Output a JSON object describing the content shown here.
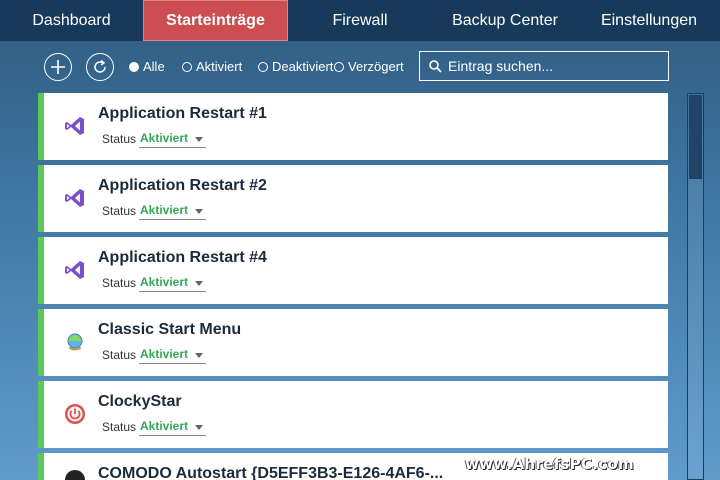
{
  "tabs": [
    {
      "label": "Dashboard",
      "active": false
    },
    {
      "label": "Starteinträge",
      "active": true
    },
    {
      "label": "Firewall",
      "active": false
    },
    {
      "label": "Backup Center",
      "active": false
    },
    {
      "label": "Einstellungen",
      "active": false
    }
  ],
  "toolbar": {
    "add_icon": "plus-icon",
    "refresh_icon": "refresh-icon",
    "filters": [
      {
        "label": "Alle",
        "checked": true
      },
      {
        "label": "Aktiviert",
        "checked": false
      },
      {
        "label": "Deaktiviert",
        "checked": false
      },
      {
        "label": "Verzögert",
        "checked": false
      }
    ],
    "search_placeholder": "Eintrag suchen..."
  },
  "entries": [
    {
      "title": "Application Restart #1",
      "status_label": "Status",
      "status": "Aktiviert",
      "icon": "visual-studio-icon"
    },
    {
      "title": "Application Restart #2",
      "status_label": "Status",
      "status": "Aktiviert",
      "icon": "visual-studio-icon"
    },
    {
      "title": "Application Restart #4",
      "status_label": "Status",
      "status": "Aktiviert",
      "icon": "visual-studio-icon"
    },
    {
      "title": "Classic Start Menu",
      "status_label": "Status",
      "status": "Aktiviert",
      "icon": "shell-icon"
    },
    {
      "title": "ClockyStar",
      "status_label": "Status",
      "status": "Aktiviert",
      "icon": "power-icon"
    },
    {
      "title": "COMODO Autostart {D5EFF3B3-E126-4AF6-...",
      "status_label": "",
      "status": "",
      "icon": "comodo-icon"
    }
  ],
  "colors": {
    "topbar": "#173a5a",
    "active_tab": "#cd4e50",
    "status_green": "#33a852",
    "item_accent": "#5cc75a"
  },
  "watermark": "www.AhrefsPC.com"
}
